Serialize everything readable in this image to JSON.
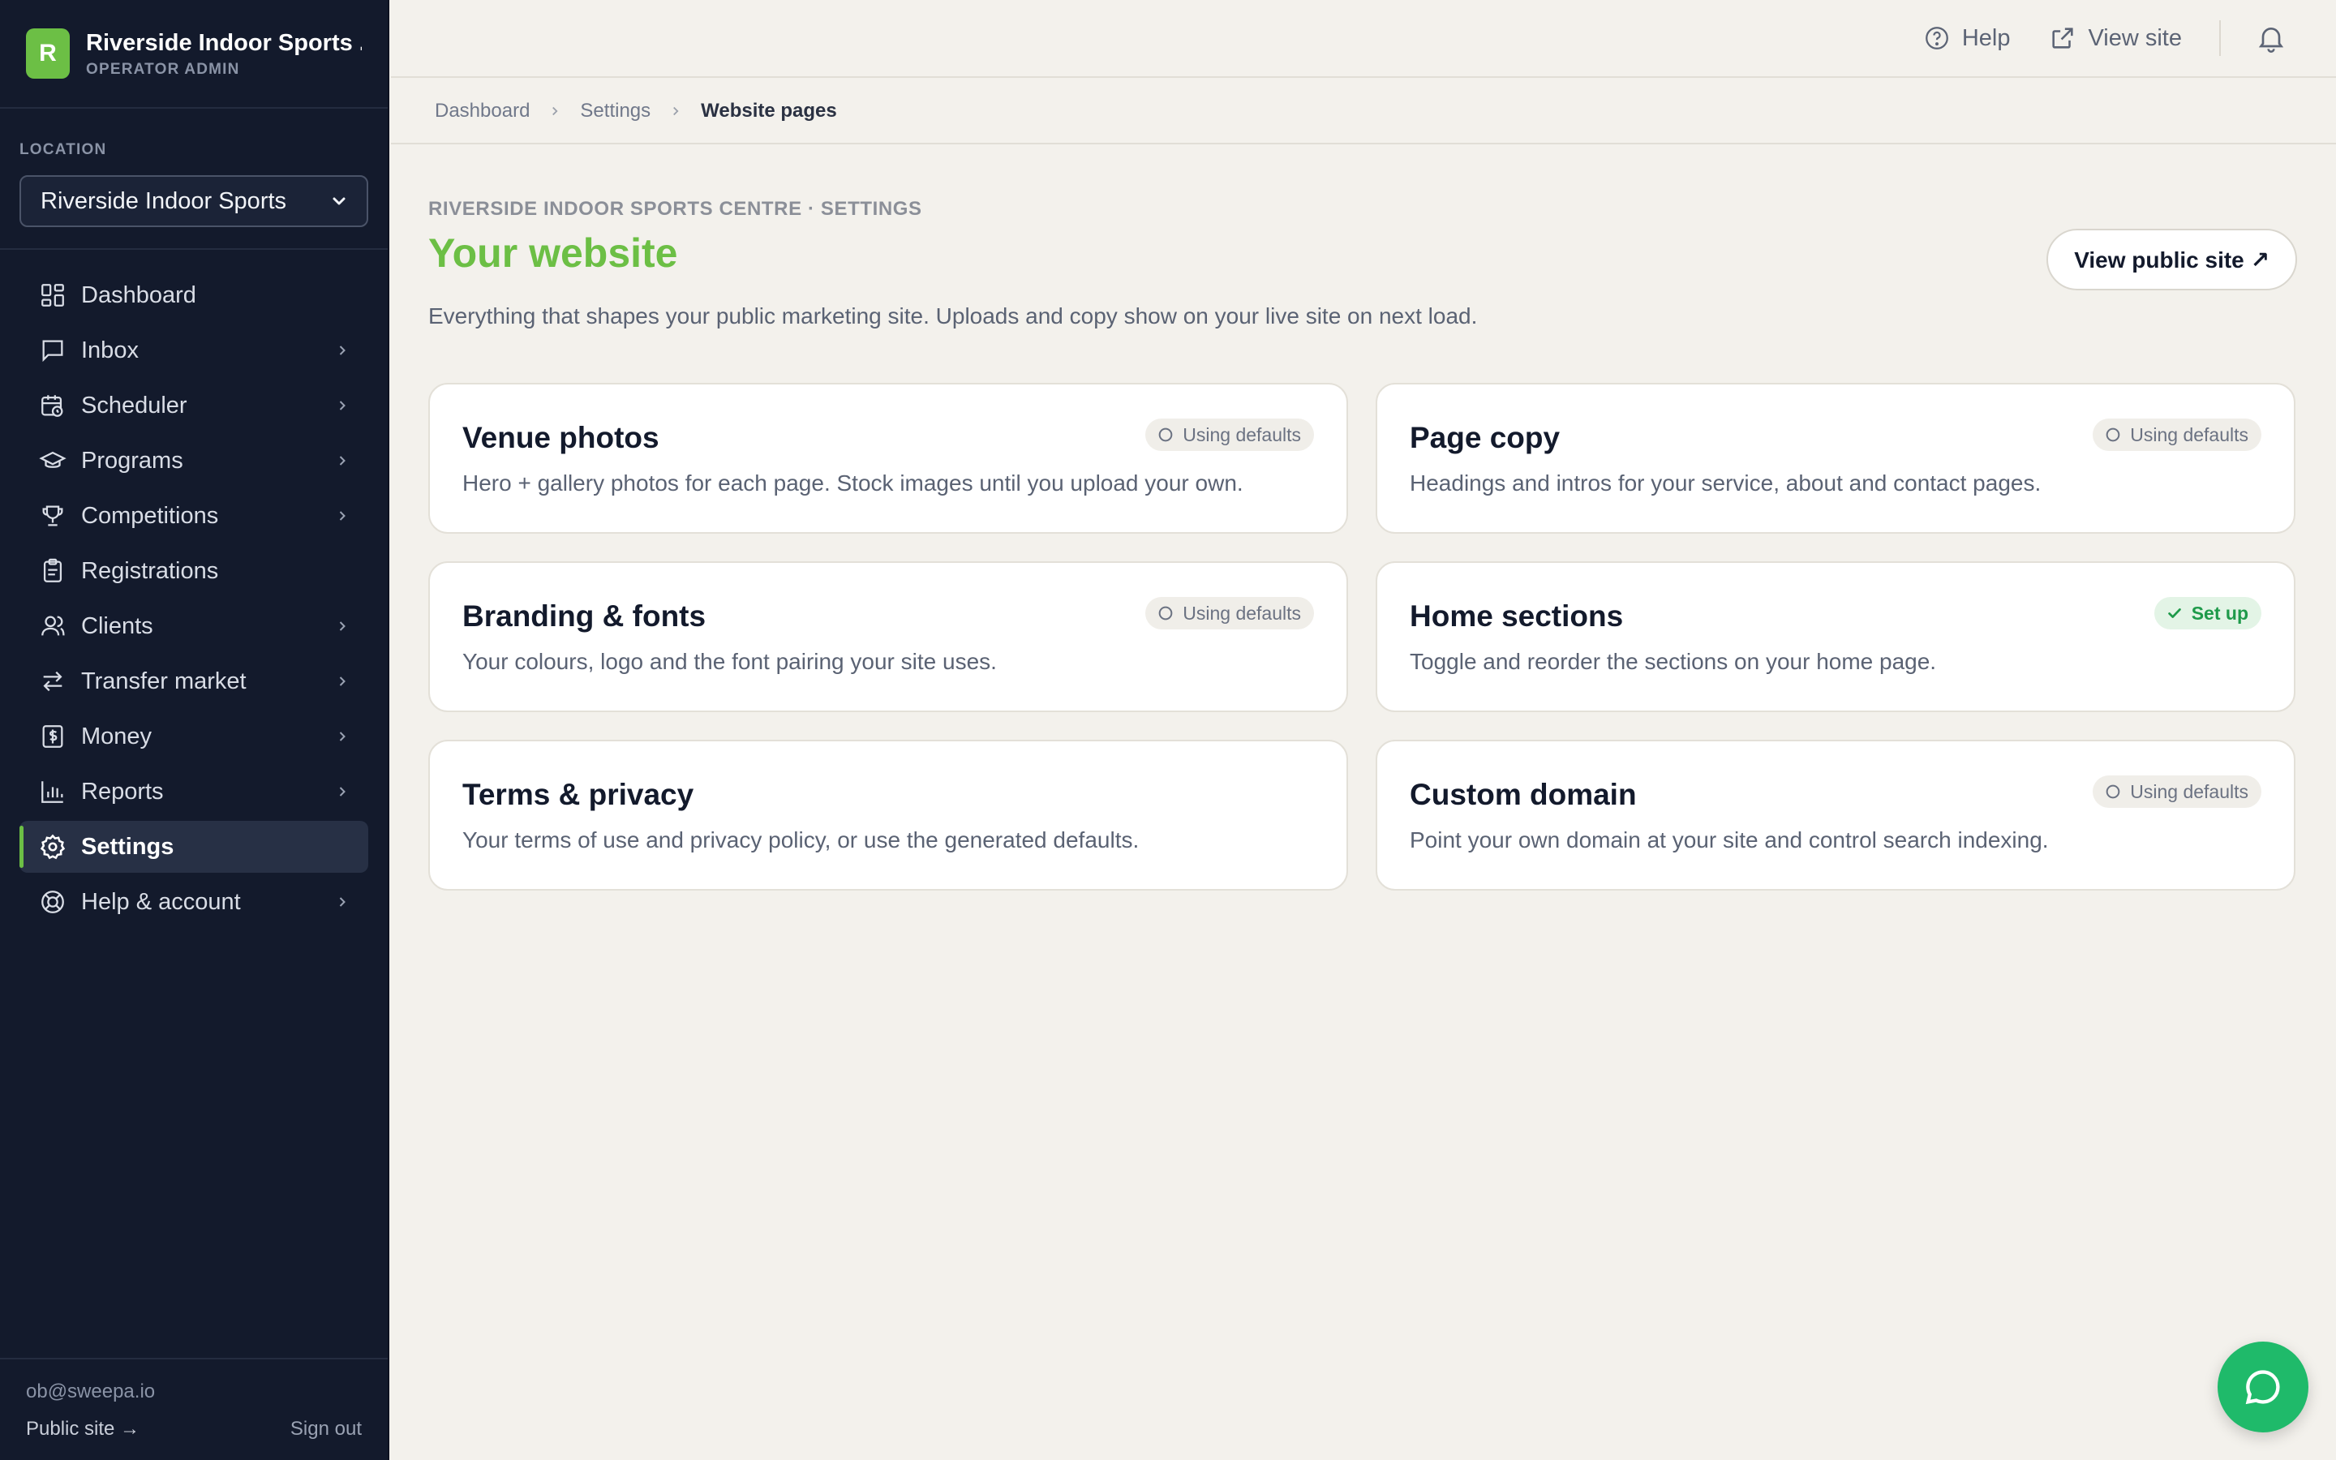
{
  "brand": {
    "initial": "R",
    "name": "Riverside Indoor Sports ...",
    "role": "OPERATOR ADMIN",
    "accent": "#6cbf45"
  },
  "location": {
    "label": "LOCATION",
    "selected": "Riverside Indoor Sports"
  },
  "nav": {
    "items": [
      {
        "label": "Dashboard",
        "icon": "dashboard-icon",
        "chevron": false
      },
      {
        "label": "Inbox",
        "icon": "inbox-icon",
        "chevron": true
      },
      {
        "label": "Scheduler",
        "icon": "calendar-clock-icon",
        "chevron": true
      },
      {
        "label": "Programs",
        "icon": "graduation-cap-icon",
        "chevron": true
      },
      {
        "label": "Competitions",
        "icon": "trophy-icon",
        "chevron": true
      },
      {
        "label": "Registrations",
        "icon": "clipboard-icon",
        "chevron": false
      },
      {
        "label": "Clients",
        "icon": "users-icon",
        "chevron": true
      },
      {
        "label": "Transfer market",
        "icon": "arrows-swap-icon",
        "chevron": true
      },
      {
        "label": "Money",
        "icon": "receipt-icon",
        "chevron": true
      },
      {
        "label": "Reports",
        "icon": "bar-chart-icon",
        "chevron": true
      },
      {
        "label": "Settings",
        "icon": "gear-icon",
        "chevron": false,
        "active": true
      },
      {
        "label": "Help & account",
        "icon": "lifebuoy-icon",
        "chevron": true
      }
    ]
  },
  "footer": {
    "email": "ob@sweepa.io",
    "public_site": "Public site →",
    "sign_out": "Sign out"
  },
  "topbar": {
    "help": "Help",
    "view_site": "View site"
  },
  "breadcrumb": {
    "items": [
      "Dashboard",
      "Settings"
    ],
    "current": "Website pages"
  },
  "page": {
    "eyebrow": "RIVERSIDE INDOOR SPORTS CENTRE · SETTINGS",
    "title": "Your website",
    "description": "Everything that shapes your public marketing site. Uploads and copy show on your live site on next load.",
    "view_public": "View public site ↗"
  },
  "cards": [
    {
      "title": "Venue photos",
      "desc": "Hero + gallery photos for each page. Stock images until you upload your own.",
      "badge": "Using defaults",
      "badge_type": "default"
    },
    {
      "title": "Page copy",
      "desc": "Headings and intros for your service, about and contact pages.",
      "badge": "Using defaults",
      "badge_type": "default"
    },
    {
      "title": "Branding & fonts",
      "desc": "Your colours, logo and the font pairing your site uses.",
      "badge": "Using defaults",
      "badge_type": "default"
    },
    {
      "title": "Home sections",
      "desc": "Toggle and reorder the sections on your home page.",
      "badge": "Set up",
      "badge_type": "setup"
    },
    {
      "title": "Terms & privacy",
      "desc": "Your terms of use and privacy policy, or use the generated defaults.",
      "badge": "",
      "badge_type": "none"
    },
    {
      "title": "Custom domain",
      "desc": "Point your own domain at your site and control search indexing.",
      "badge": "Using defaults",
      "badge_type": "default"
    }
  ]
}
